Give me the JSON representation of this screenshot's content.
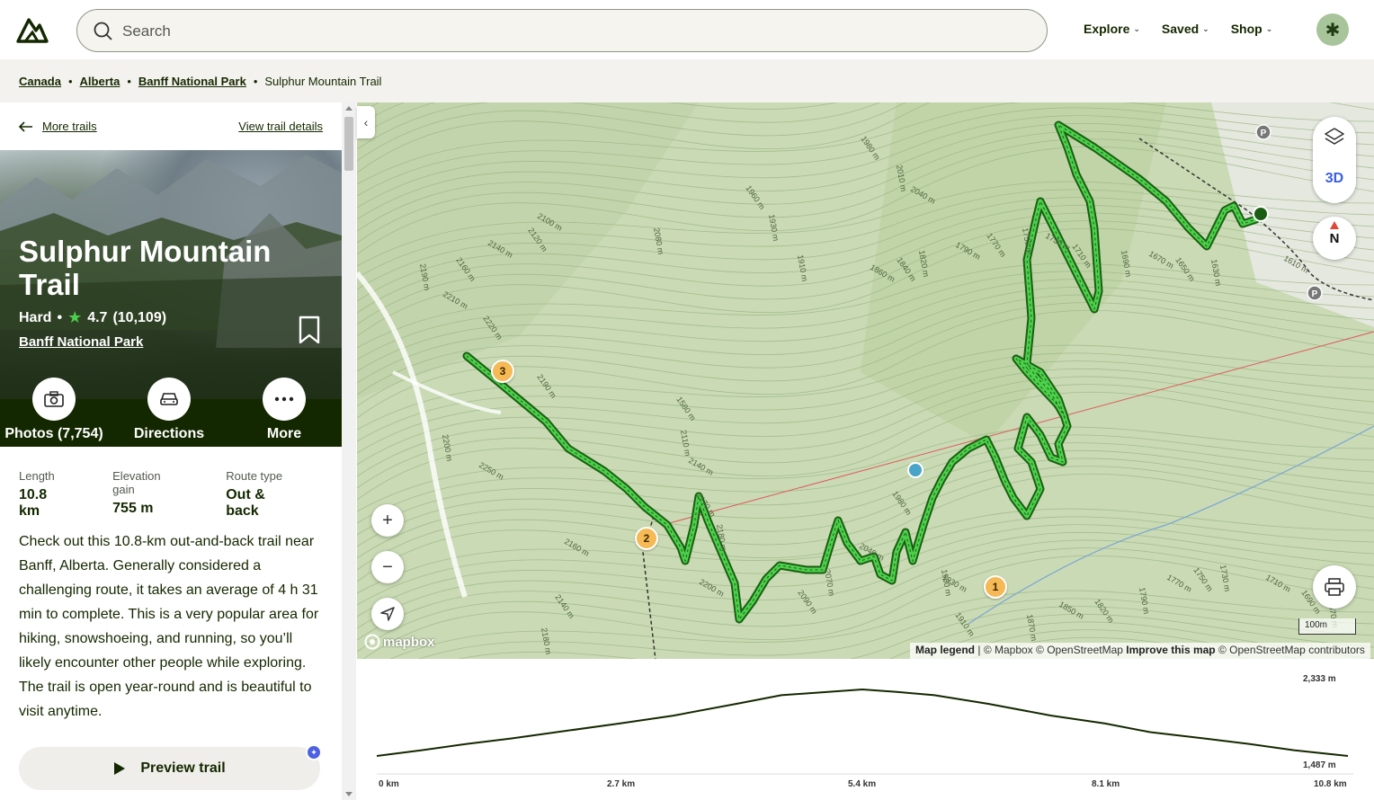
{
  "header": {
    "search_placeholder": "Search",
    "nav": [
      {
        "label": "Explore"
      },
      {
        "label": "Saved"
      },
      {
        "label": "Shop"
      }
    ]
  },
  "breadcrumb": {
    "items": [
      "Canada",
      "Alberta",
      "Banff National Park"
    ],
    "current": "Sulphur Mountain Trail"
  },
  "panel": {
    "back_label": "More trails",
    "details_label": "View trail details",
    "title": "Sulphur Mountain Trail",
    "difficulty": "Hard",
    "rating": "4.7",
    "reviews": "(10,109)",
    "park": "Banff National Park",
    "actions": [
      {
        "label": "Photos (7,754)",
        "icon": "camera-icon"
      },
      {
        "label": "Directions",
        "icon": "car-icon"
      },
      {
        "label": "More",
        "icon": "more-icon"
      }
    ],
    "stats": [
      {
        "label": "Length",
        "value": "10.8 km"
      },
      {
        "label": "Elevation gain",
        "value": "755 m"
      },
      {
        "label": "Route type",
        "value": "Out & back"
      }
    ],
    "description": "Check out this 10.8-km out-and-back trail near Banff, Alberta. Generally considered a challenging route, it takes an average of 4 h 31 min to complete. This is a very popular area for hiking, snowshoeing, and running, so you’ll likely encounter other people while exploring. The trail is open year-round and is beautiful to visit anytime.",
    "preview_label": "Preview trail"
  },
  "map": {
    "three_d_label": "3D",
    "compass_label": "N",
    "mapbox_label": "mapbox",
    "attribution": {
      "legend": "Map legend",
      "mapbox": "© Mapbox",
      "osm": "© OpenStreetMap",
      "improve": "Improve this map",
      "contributors": "© OpenStreetMap contributors"
    },
    "scale_label": "100m",
    "markers": [
      "1",
      "2",
      "3"
    ],
    "contour_labels": [
      "1980 m",
      "2010 m",
      "2040 m",
      "1960 m",
      "1930 m",
      "2100 m",
      "2120 m",
      "2080 m",
      "2140 m",
      "2160 m",
      "2190 m",
      "2210 m",
      "2220 m",
      "1910 m",
      "1860 m",
      "1840 m",
      "1820 m",
      "1790 m",
      "1770 m",
      "1750 m",
      "1730 m",
      "1710 m",
      "1690 m",
      "1670 m",
      "1650 m",
      "1630 m",
      "1610 m",
      "1580 m",
      "2110 m",
      "2140 m",
      "2170 m",
      "2200 m",
      "2250 m",
      "2190 m",
      "2180 m",
      "2160 m",
      "2140 m",
      "2180 m",
      "2200 m",
      "2090 m",
      "2070 m",
      "2040 m",
      "1980 m",
      "1960 m",
      "1930 m",
      "1910 m",
      "1870 m",
      "1850 m",
      "1820 m",
      "1790 m",
      "1770 m",
      "1750 m",
      "1730 m",
      "1710 m",
      "1690 m",
      "1670 m"
    ],
    "colors": {
      "trail": "#4cd14c",
      "trail_outline": "#1b5e12",
      "map_bg": "#c7d9b2",
      "marker": "#f5b955"
    }
  },
  "elevation": {
    "max_label": "2,333 m",
    "min_label": "1,487 m",
    "x_ticks": [
      "0 km",
      "2.7 km",
      "5.4 km",
      "8.1 km",
      "10.8 km"
    ],
    "profile_km": [
      0,
      0.5,
      1.0,
      1.5,
      2.0,
      2.7,
      3.3,
      4.0,
      4.5,
      5.0,
      5.4,
      5.8,
      6.2,
      6.8,
      7.5,
      8.1,
      8.6,
      9.2,
      9.7,
      10.2,
      10.8
    ],
    "profile_m": [
      1487,
      1560,
      1640,
      1710,
      1790,
      1900,
      2000,
      2150,
      2260,
      2300,
      2333,
      2300,
      2260,
      2150,
      2000,
      1900,
      1790,
      1710,
      1640,
      1560,
      1487
    ]
  }
}
